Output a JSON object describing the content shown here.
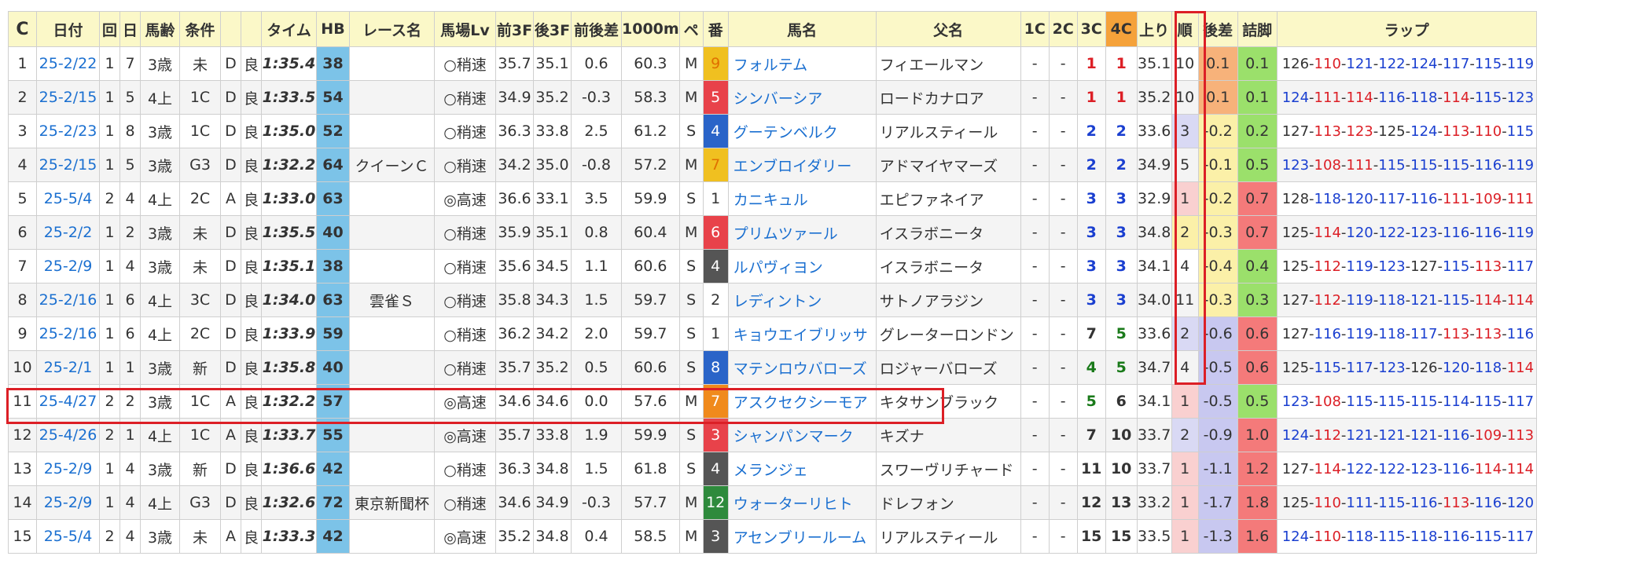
{
  "headers": {
    "refresh": "C",
    "date": "日付",
    "kai": "回",
    "day": "日",
    "age": "馬齢",
    "cond": "条件",
    "surface": "",
    "going": "",
    "time": "タイム",
    "hb": "HB",
    "race_name": "レース名",
    "track_lv": "馬場Lv",
    "first3f": "前3F",
    "last3f": "後3F",
    "diff": "前後差",
    "t1000": "1000m",
    "pace": "ペ",
    "num": "番",
    "horse": "馬名",
    "sire": "父名",
    "c1": "1C",
    "c2": "2C",
    "c3": "3C",
    "c4": "4C",
    "agari": "上り",
    "rank": "順",
    "margin": "後差",
    "tsume": "詰脚",
    "lap": "ラップ"
  },
  "colors": {
    "header_bg": "#fbf8c8",
    "hb_bg": "#7cc3e8",
    "highlight": "#dc1f26",
    "link": "#1a6fd0"
  },
  "rows": [
    {
      "idx": "1",
      "date": "25-2/22",
      "kai": "1",
      "day": "7",
      "age": "3歳",
      "cond": "未",
      "surface": "D",
      "going": "良",
      "time": "1:35.4",
      "hb": "38",
      "race": "",
      "lv": "○稍速",
      "f3": "35.7",
      "l3": "35.1",
      "diff": "0.6",
      "t1000": "60.3",
      "pace": "M",
      "num": "9",
      "num_bg": "#f0c020",
      "num_fg": "#e07000",
      "horse": "フォルテム",
      "sire": "フィエールマン",
      "c1": "-",
      "c2": "-",
      "c3": "1",
      "c3c": "r",
      "c4": "1",
      "c4c": "r",
      "agari": "35.1",
      "rank": "10",
      "rank_bg": "",
      "margin": "0.1",
      "margin_bg": "#f7b27a",
      "tsume": "0.1",
      "tsume_bg": "#9be06b",
      "lap": [
        [
          "126",
          "k"
        ],
        [
          "110",
          "r"
        ],
        [
          "121",
          "b"
        ],
        [
          "122",
          "b"
        ],
        [
          "124",
          "b"
        ],
        [
          "117",
          "b"
        ],
        [
          "115",
          "b"
        ],
        [
          "119",
          "b"
        ]
      ]
    },
    {
      "idx": "2",
      "date": "25-2/15",
      "kai": "1",
      "day": "5",
      "age": "4上",
      "cond": "1C",
      "surface": "D",
      "going": "良",
      "time": "1:33.5",
      "hb": "54",
      "race": "",
      "lv": "○稍速",
      "f3": "34.9",
      "l3": "35.2",
      "diff": "-0.3",
      "t1000": "58.3",
      "pace": "M",
      "num": "5",
      "num_bg": "#e8424a",
      "num_fg": "#ffffff",
      "horse": "シンバーシア",
      "sire": "ロードカナロア",
      "c1": "-",
      "c2": "-",
      "c3": "1",
      "c3c": "r",
      "c4": "1",
      "c4c": "r",
      "agari": "35.2",
      "rank": "10",
      "rank_bg": "",
      "margin": "0.1",
      "margin_bg": "#f7b27a",
      "tsume": "0.1",
      "tsume_bg": "#9be06b",
      "lap": [
        [
          "124",
          "b"
        ],
        [
          "111",
          "r"
        ],
        [
          "114",
          "r"
        ],
        [
          "116",
          "b"
        ],
        [
          "118",
          "b"
        ],
        [
          "114",
          "r"
        ],
        [
          "115",
          "b"
        ],
        [
          "123",
          "b"
        ]
      ]
    },
    {
      "idx": "3",
      "date": "25-2/23",
      "kai": "1",
      "day": "8",
      "age": "3歳",
      "cond": "1C",
      "surface": "D",
      "going": "良",
      "time": "1:35.0",
      "hb": "52",
      "race": "",
      "lv": "○稍速",
      "f3": "36.3",
      "l3": "33.8",
      "diff": "2.5",
      "t1000": "61.2",
      "pace": "S",
      "num": "4",
      "num_bg": "#2a64c8",
      "num_fg": "#ffffff",
      "horse": "グーテンベルク",
      "sire": "リアルスティール",
      "c1": "-",
      "c2": "-",
      "c3": "2",
      "c3c": "b",
      "c4": "2",
      "c4c": "b",
      "agari": "33.6",
      "rank": "3",
      "rank_bg": "#d9d9f4",
      "margin": "-0.2",
      "margin_bg": "#fbf0a8",
      "tsume": "0.2",
      "tsume_bg": "#9be06b",
      "lap": [
        [
          "127",
          "k"
        ],
        [
          "113",
          "r"
        ],
        [
          "123",
          "r"
        ],
        [
          "125",
          "k"
        ],
        [
          "124",
          "b"
        ],
        [
          "113",
          "r"
        ],
        [
          "110",
          "r"
        ],
        [
          "115",
          "b"
        ]
      ]
    },
    {
      "idx": "4",
      "date": "25-2/15",
      "kai": "1",
      "day": "5",
      "age": "3歳",
      "cond": "G3",
      "surface": "D",
      "going": "良",
      "time": "1:32.2",
      "hb": "64",
      "race": "クイーンＣ",
      "lv": "○稍速",
      "f3": "34.2",
      "l3": "35.0",
      "diff": "-0.8",
      "t1000": "57.2",
      "pace": "M",
      "num": "7",
      "num_bg": "#f0c020",
      "num_fg": "#e07000",
      "horse": "エンブロイダリー",
      "sire": "アドマイヤマーズ",
      "c1": "-",
      "c2": "-",
      "c3": "2",
      "c3c": "b",
      "c4": "2",
      "c4c": "b",
      "agari": "34.9",
      "rank": "5",
      "rank_bg": "",
      "margin": "-0.1",
      "margin_bg": "#fbf0a8",
      "tsume": "0.5",
      "tsume_bg": "#9be06b",
      "lap": [
        [
          "123",
          "b"
        ],
        [
          "108",
          "r"
        ],
        [
          "111",
          "r"
        ],
        [
          "115",
          "b"
        ],
        [
          "115",
          "b"
        ],
        [
          "115",
          "b"
        ],
        [
          "116",
          "b"
        ],
        [
          "119",
          "b"
        ]
      ]
    },
    {
      "idx": "5",
      "date": "25-5/4",
      "kai": "2",
      "day": "4",
      "age": "4上",
      "cond": "2C",
      "surface": "A",
      "going": "良",
      "time": "1:33.0",
      "hb": "63",
      "race": "",
      "lv": "◎高速",
      "f3": "36.6",
      "l3": "33.1",
      "diff": "3.5",
      "t1000": "59.9",
      "pace": "S",
      "num": "1",
      "num_bg": "#ffffff",
      "num_fg": "#333333",
      "horse": "カニキュル",
      "sire": "エピファネイア",
      "c1": "-",
      "c2": "-",
      "c3": "3",
      "c3c": "b",
      "c4": "3",
      "c4c": "b",
      "agari": "32.9",
      "rank": "1",
      "rank_bg": "#f9d0d0",
      "margin": "-0.2",
      "margin_bg": "#fbf0a8",
      "tsume": "0.7",
      "tsume_bg": "#f47a7a",
      "lap": [
        [
          "128",
          "k"
        ],
        [
          "118",
          "b"
        ],
        [
          "120",
          "b"
        ],
        [
          "117",
          "b"
        ],
        [
          "116",
          "b"
        ],
        [
          "111",
          "r"
        ],
        [
          "109",
          "r"
        ],
        [
          "111",
          "r"
        ]
      ]
    },
    {
      "idx": "6",
      "date": "25-2/2",
      "kai": "1",
      "day": "2",
      "age": "3歳",
      "cond": "未",
      "surface": "D",
      "going": "良",
      "time": "1:35.5",
      "hb": "40",
      "race": "",
      "lv": "○稍速",
      "f3": "35.9",
      "l3": "35.1",
      "diff": "0.8",
      "t1000": "60.4",
      "pace": "M",
      "num": "6",
      "num_bg": "#e8424a",
      "num_fg": "#ffffff",
      "horse": "プリムツァール",
      "sire": "イスラボニータ",
      "c1": "-",
      "c2": "-",
      "c3": "3",
      "c3c": "b",
      "c4": "3",
      "c4c": "b",
      "agari": "34.8",
      "rank": "2",
      "rank_bg": "#fbf0a8",
      "margin": "-0.3",
      "margin_bg": "#fbf0a8",
      "tsume": "0.7",
      "tsume_bg": "#f47a7a",
      "lap": [
        [
          "125",
          "k"
        ],
        [
          "114",
          "r"
        ],
        [
          "120",
          "b"
        ],
        [
          "122",
          "b"
        ],
        [
          "123",
          "b"
        ],
        [
          "116",
          "b"
        ],
        [
          "116",
          "b"
        ],
        [
          "119",
          "b"
        ]
      ]
    },
    {
      "idx": "7",
      "date": "25-2/9",
      "kai": "1",
      "day": "4",
      "age": "3歳",
      "cond": "未",
      "surface": "D",
      "going": "良",
      "time": "1:35.1",
      "hb": "38",
      "race": "",
      "lv": "○稍速",
      "f3": "35.6",
      "l3": "34.5",
      "diff": "1.1",
      "t1000": "60.6",
      "pace": "S",
      "num": "4",
      "num_bg": "#555555",
      "num_fg": "#ffffff",
      "horse": "ルパヴィヨン",
      "sire": "イスラボニータ",
      "c1": "-",
      "c2": "-",
      "c3": "3",
      "c3c": "b",
      "c4": "3",
      "c4c": "b",
      "agari": "34.1",
      "rank": "4",
      "rank_bg": "",
      "margin": "-0.4",
      "margin_bg": "#fbf0a8",
      "tsume": "0.4",
      "tsume_bg": "#9be06b",
      "lap": [
        [
          "125",
          "k"
        ],
        [
          "112",
          "r"
        ],
        [
          "119",
          "b"
        ],
        [
          "123",
          "b"
        ],
        [
          "127",
          "k"
        ],
        [
          "115",
          "b"
        ],
        [
          "113",
          "r"
        ],
        [
          "117",
          "b"
        ]
      ]
    },
    {
      "idx": "8",
      "date": "25-2/16",
      "kai": "1",
      "day": "6",
      "age": "4上",
      "cond": "3C",
      "surface": "D",
      "going": "良",
      "time": "1:34.0",
      "hb": "63",
      "race": "雲雀Ｓ",
      "lv": "○稍速",
      "f3": "35.8",
      "l3": "34.3",
      "diff": "1.5",
      "t1000": "59.7",
      "pace": "S",
      "num": "2",
      "num_bg": "#ffffff",
      "num_fg": "#333333",
      "horse": "レディントン",
      "sire": "サトノアラジン",
      "c1": "-",
      "c2": "-",
      "c3": "3",
      "c3c": "b",
      "c4": "3",
      "c4c": "b",
      "agari": "34.0",
      "rank": "11",
      "rank_bg": "",
      "margin": "-0.3",
      "margin_bg": "#fbf0a8",
      "tsume": "0.3",
      "tsume_bg": "#9be06b",
      "lap": [
        [
          "127",
          "k"
        ],
        [
          "112",
          "r"
        ],
        [
          "119",
          "b"
        ],
        [
          "118",
          "b"
        ],
        [
          "121",
          "b"
        ],
        [
          "115",
          "b"
        ],
        [
          "114",
          "r"
        ],
        [
          "114",
          "r"
        ]
      ]
    },
    {
      "idx": "9",
      "date": "25-2/16",
      "kai": "1",
      "day": "6",
      "age": "4上",
      "cond": "2C",
      "surface": "D",
      "going": "良",
      "time": "1:33.9",
      "hb": "59",
      "race": "",
      "lv": "○稍速",
      "f3": "36.2",
      "l3": "34.2",
      "diff": "2.0",
      "t1000": "59.7",
      "pace": "S",
      "num": "1",
      "num_bg": "#ffffff",
      "num_fg": "#333333",
      "horse": "キョウエイブリッサ",
      "sire": "グレーターロンドン",
      "c1": "-",
      "c2": "-",
      "c3": "7",
      "c3c": "k",
      "c4": "5",
      "c4c": "g",
      "agari": "33.6",
      "rank": "2",
      "rank_bg": "#d9d9f4",
      "margin": "-0.6",
      "margin_bg": "#c8c8f0",
      "tsume": "0.6",
      "tsume_bg": "#f47a7a",
      "lap": [
        [
          "127",
          "k"
        ],
        [
          "116",
          "b"
        ],
        [
          "119",
          "b"
        ],
        [
          "118",
          "b"
        ],
        [
          "117",
          "b"
        ],
        [
          "113",
          "r"
        ],
        [
          "113",
          "r"
        ],
        [
          "116",
          "b"
        ]
      ]
    },
    {
      "idx": "10",
      "date": "25-2/1",
      "kai": "1",
      "day": "1",
      "age": "3歳",
      "cond": "新",
      "surface": "D",
      "going": "良",
      "time": "1:35.8",
      "hb": "40",
      "race": "",
      "lv": "○稍速",
      "f3": "35.7",
      "l3": "35.2",
      "diff": "0.5",
      "t1000": "60.6",
      "pace": "S",
      "num": "8",
      "num_bg": "#2a64c8",
      "num_fg": "#ffffff",
      "horse": "マテンロウバローズ",
      "sire": "ロジャーバローズ",
      "c1": "-",
      "c2": "-",
      "c3": "4",
      "c3c": "g",
      "c4": "5",
      "c4c": "g",
      "agari": "34.7",
      "rank": "4",
      "rank_bg": "",
      "margin": "-0.5",
      "margin_bg": "#c8c8f0",
      "tsume": "0.6",
      "tsume_bg": "#f47a7a",
      "lap": [
        [
          "125",
          "k"
        ],
        [
          "115",
          "b"
        ],
        [
          "117",
          "b"
        ],
        [
          "123",
          "b"
        ],
        [
          "126",
          "k"
        ],
        [
          "120",
          "b"
        ],
        [
          "118",
          "b"
        ],
        [
          "114",
          "r"
        ]
      ]
    },
    {
      "idx": "11",
      "date": "25-4/27",
      "kai": "2",
      "day": "2",
      "age": "3歳",
      "cond": "1C",
      "surface": "A",
      "going": "良",
      "time": "1:32.2",
      "hb": "57",
      "race": "",
      "lv": "◎高速",
      "f3": "34.6",
      "l3": "34.6",
      "diff": "0.0",
      "t1000": "57.6",
      "pace": "M",
      "num": "7",
      "num_bg": "#f08a1c",
      "num_fg": "#ffffff",
      "horse": "アスクセクシーモア",
      "sire": "キタサンブラック",
      "c1": "-",
      "c2": "-",
      "c3": "5",
      "c3c": "g",
      "c4": "6",
      "c4c": "k",
      "agari": "34.1",
      "rank": "1",
      "rank_bg": "#f9d0d0",
      "margin": "-0.5",
      "margin_bg": "#c8c8f0",
      "tsume": "0.5",
      "tsume_bg": "#9be06b",
      "lap": [
        [
          "123",
          "b"
        ],
        [
          "108",
          "r"
        ],
        [
          "115",
          "b"
        ],
        [
          "115",
          "b"
        ],
        [
          "115",
          "b"
        ],
        [
          "114",
          "b"
        ],
        [
          "115",
          "b"
        ],
        [
          "117",
          "b"
        ]
      ]
    },
    {
      "idx": "12",
      "date": "25-4/26",
      "kai": "2",
      "day": "1",
      "age": "4上",
      "cond": "1C",
      "surface": "A",
      "going": "良",
      "time": "1:33.7",
      "hb": "55",
      "race": "",
      "lv": "◎高速",
      "f3": "35.7",
      "l3": "33.8",
      "diff": "1.9",
      "t1000": "59.9",
      "pace": "S",
      "num": "3",
      "num_bg": "#e8424a",
      "num_fg": "#ffffff",
      "horse": "シャンパンマーク",
      "sire": "キズナ",
      "c1": "-",
      "c2": "-",
      "c3": "7",
      "c3c": "k",
      "c4": "10",
      "c4c": "k",
      "agari": "33.7",
      "rank": "2",
      "rank_bg": "#d9d9f4",
      "margin": "-0.9",
      "margin_bg": "#c8c8f0",
      "tsume": "1.0",
      "tsume_bg": "#f47a7a",
      "lap": [
        [
          "124",
          "b"
        ],
        [
          "112",
          "r"
        ],
        [
          "121",
          "b"
        ],
        [
          "121",
          "b"
        ],
        [
          "121",
          "b"
        ],
        [
          "116",
          "b"
        ],
        [
          "109",
          "r"
        ],
        [
          "113",
          "r"
        ]
      ]
    },
    {
      "idx": "13",
      "date": "25-2/9",
      "kai": "1",
      "day": "4",
      "age": "3歳",
      "cond": "新",
      "surface": "D",
      "going": "良",
      "time": "1:36.6",
      "hb": "42",
      "race": "",
      "lv": "○稍速",
      "f3": "36.3",
      "l3": "34.8",
      "diff": "1.5",
      "t1000": "61.8",
      "pace": "S",
      "num": "4",
      "num_bg": "#555555",
      "num_fg": "#ffffff",
      "horse": "メランジェ",
      "sire": "スワーヴリチャード",
      "c1": "-",
      "c2": "-",
      "c3": "11",
      "c3c": "k",
      "c4": "10",
      "c4c": "k",
      "agari": "33.7",
      "rank": "1",
      "rank_bg": "#f9d0d0",
      "margin": "-1.1",
      "margin_bg": "#c8c8f0",
      "tsume": "1.2",
      "tsume_bg": "#f47a7a",
      "lap": [
        [
          "127",
          "k"
        ],
        [
          "114",
          "r"
        ],
        [
          "122",
          "b"
        ],
        [
          "122",
          "b"
        ],
        [
          "123",
          "b"
        ],
        [
          "116",
          "b"
        ],
        [
          "114",
          "r"
        ],
        [
          "114",
          "r"
        ]
      ]
    },
    {
      "idx": "14",
      "date": "25-2/9",
      "kai": "1",
      "day": "4",
      "age": "4上",
      "cond": "G3",
      "surface": "D",
      "going": "良",
      "time": "1:32.6",
      "hb": "72",
      "race": "東京新聞杯",
      "lv": "○稍速",
      "f3": "34.6",
      "l3": "34.9",
      "diff": "-0.3",
      "t1000": "57.7",
      "pace": "M",
      "num": "12",
      "num_bg": "#2e8a3c",
      "num_fg": "#ffffff",
      "horse": "ウォーターリヒト",
      "sire": "ドレフォン",
      "c1": "-",
      "c2": "-",
      "c3": "12",
      "c3c": "k",
      "c4": "13",
      "c4c": "k",
      "agari": "33.2",
      "rank": "1",
      "rank_bg": "#f9d0d0",
      "margin": "-1.7",
      "margin_bg": "#c8c8f0",
      "tsume": "1.8",
      "tsume_bg": "#f47a7a",
      "lap": [
        [
          "125",
          "k"
        ],
        [
          "110",
          "r"
        ],
        [
          "111",
          "b"
        ],
        [
          "115",
          "b"
        ],
        [
          "116",
          "b"
        ],
        [
          "113",
          "r"
        ],
        [
          "116",
          "b"
        ],
        [
          "120",
          "b"
        ]
      ]
    },
    {
      "idx": "15",
      "date": "25-5/4",
      "kai": "2",
      "day": "4",
      "age": "3歳",
      "cond": "未",
      "surface": "A",
      "going": "良",
      "time": "1:33.3",
      "hb": "42",
      "race": "",
      "lv": "◎高速",
      "f3": "35.2",
      "l3": "34.8",
      "diff": "0.4",
      "t1000": "58.5",
      "pace": "M",
      "num": "3",
      "num_bg": "#555555",
      "num_fg": "#ffffff",
      "horse": "アセンブリールーム",
      "sire": "リアルスティール",
      "c1": "-",
      "c2": "-",
      "c3": "15",
      "c3c": "k",
      "c4": "15",
      "c4c": "k",
      "agari": "33.5",
      "rank": "1",
      "rank_bg": "#f9d0d0",
      "margin": "-1.3",
      "margin_bg": "#c8c8f0",
      "tsume": "1.6",
      "tsume_bg": "#f47a7a",
      "lap": [
        [
          "124",
          "b"
        ],
        [
          "110",
          "r"
        ],
        [
          "118",
          "b"
        ],
        [
          "115",
          "b"
        ],
        [
          "118",
          "b"
        ],
        [
          "116",
          "b"
        ],
        [
          "115",
          "b"
        ],
        [
          "117",
          "b"
        ]
      ]
    }
  ]
}
